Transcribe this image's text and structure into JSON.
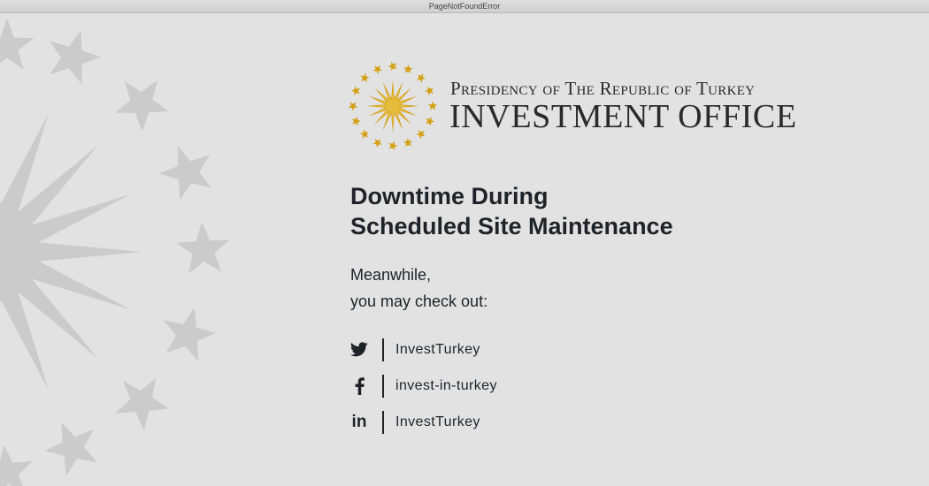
{
  "window": {
    "title": "PageNotFoundError"
  },
  "logo": {
    "line1": "Presidency of The Republic of Turkey",
    "line2": "INVESTMENT OFFICE",
    "colors": {
      "gold": "#d4a017",
      "text": "#2a2a2a"
    }
  },
  "main": {
    "heading_line1": "Downtime During",
    "heading_line2": "Scheduled Site Maintenance",
    "intro_line1": "Meanwhile,",
    "intro_line2": "you may check out:"
  },
  "social": [
    {
      "icon": "twitter-icon",
      "label": "InvestTurkey"
    },
    {
      "icon": "facebook-icon",
      "label": "invest-in-turkey"
    },
    {
      "icon": "linkedin-icon",
      "label": "InvestTurkey"
    }
  ],
  "colors": {
    "background": "#e2e2e2",
    "text": "#1f2328",
    "decor": "#cbcbcb"
  }
}
